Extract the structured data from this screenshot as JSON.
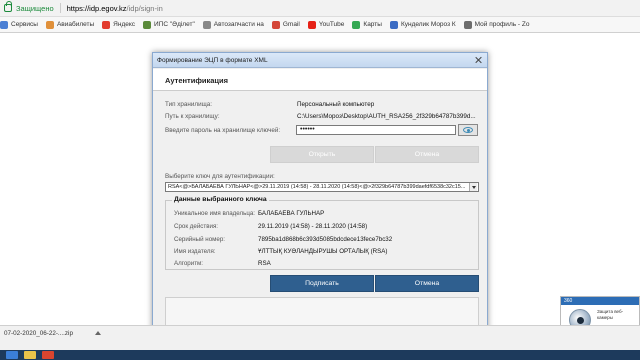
{
  "browser": {
    "secure_label": "Защищено",
    "url_host": "https://idp.egov.kz",
    "url_path": "/idp/sign-in",
    "bookmarks": [
      {
        "label": "Сервисы",
        "color": "#4a7fd4"
      },
      {
        "label": "Авиабилеты",
        "color": "#e0903a"
      },
      {
        "label": "Яндекс",
        "color": "#e23b2e"
      },
      {
        "label": "ИПС \"Әділет\"",
        "color": "#5a8a3a"
      },
      {
        "label": "Автозапчасти на",
        "color": "#888888"
      },
      {
        "label": "Gmail",
        "color": "#d44638"
      },
      {
        "label": "YouTube",
        "color": "#e62117"
      },
      {
        "label": "Карты",
        "color": "#34a853"
      },
      {
        "label": "Кунделик Мороз К",
        "color": "#3b6cc4"
      },
      {
        "label": "Мой профиль - Zo",
        "color": "#6d6d6d"
      }
    ]
  },
  "dialog": {
    "title": "Формирование ЭЦП в формате XML",
    "heading": "Аутентификация",
    "store_type_label": "Тип хранилища:",
    "store_type_value": "Персональный компьютер",
    "store_path_label": "Путь к хранилищу:",
    "store_path_value": "C:\\Users\\Мороз\\Desktop\\AUTH_RSA256_2f329b64787b399d...",
    "password_label": "Введите пароль на хранилище ключей:",
    "password_value": "••••••",
    "open_button": "Открыть",
    "cancel_button_top": "Отмена",
    "key_select_label": "Выберите ключ для аутентификации:",
    "key_select_value": "RSA<@>БАЛАБАЕВА ГУЛЬНАР<@>29.11.2019 (14:58) - 28.11.2020 (14:58)<@>2f329b64787b399daefdf6538c32c15...",
    "group_title": "Данные выбранного ключа",
    "fields": [
      {
        "label": "Уникальное имя владельца:",
        "value": "БАЛАБАЕВА ГУЛЬНАР"
      },
      {
        "label": "Срок действия:",
        "value": "29.11.2019 (14:58) - 28.11.2020 (14:58)"
      },
      {
        "label": "Серийный номер:",
        "value": "7895ba1d868b6c393d5085bdcdece13fece7bc32"
      },
      {
        "label": "Имя издателя:",
        "value": "ҰЛТТЫҚ КУӘЛАНДЫРУШЫ ОРТАЛЫҚ (RSA)"
      },
      {
        "label": "Алгоритм:",
        "value": "RSA"
      }
    ],
    "sign_button": "Подписать",
    "cancel_button": "Отмена"
  },
  "widget": {
    "header": "360",
    "text": "Защита веб-камеры"
  },
  "downloads": {
    "file": "07-02-2020_06-22-....zip"
  },
  "colors": {
    "primary_button": "#2f5f8f",
    "secure": "#1a8a3a"
  }
}
